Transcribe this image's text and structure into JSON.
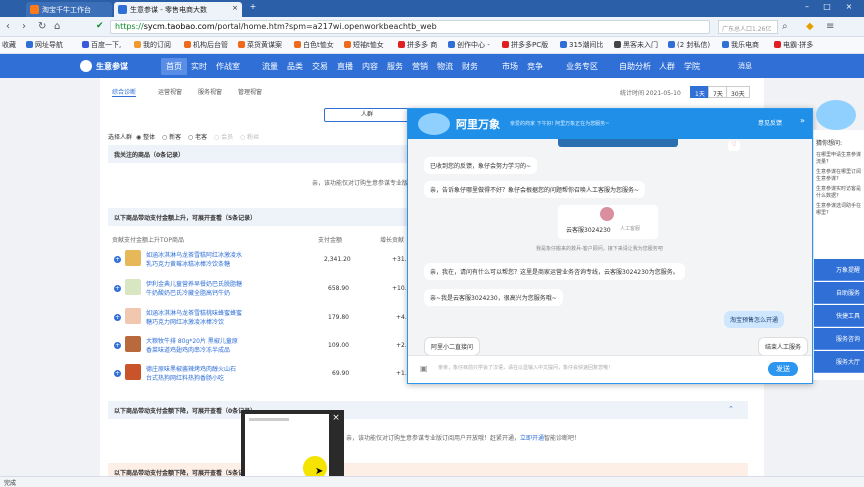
{
  "browser": {
    "tabs": [
      {
        "label": "淘宝千牛工作台",
        "active": false
      },
      {
        "label": "生意参谋 - 零售电商大数",
        "active": true
      }
    ],
    "url_scheme": "https://",
    "url_host": "sycm.taobao.com",
    "url_path": "/portal/home.htm?spm=a217wi.openworkbeachtb_web",
    "search_placeholder": "广东总人口1.26亿",
    "bookmarks": [
      "收藏",
      "网址导航",
      "百度一下,",
      "我的订阅",
      "机构后台管",
      "菜货黄谋案",
      "白色t恤女",
      "短袖t恤女",
      "拼多多 商",
      "创作中心 -",
      "拼多多PC版",
      "315潮间比",
      "黑客未入门",
      "(2 封私信)",
      "我乐电商",
      "电霸·拼多"
    ]
  },
  "sitenav": {
    "brand": "生意参谋",
    "items": [
      "首页",
      "实时",
      "作战室",
      "流量",
      "品类",
      "交易",
      "直播",
      "内容",
      "服务",
      "营销",
      "物流",
      "财务",
      "市场",
      "竞争",
      "业务专区",
      "自助分析",
      "人群",
      "学院"
    ],
    "active": "首页",
    "right": "消息"
  },
  "main": {
    "subtabs": [
      "综合诊断",
      "运营视窗",
      "服务视窗",
      "管理视窗"
    ],
    "stat_time": "统计时间 2021-05-10",
    "ranges": [
      "1天",
      "7天",
      "30天"
    ],
    "segment_left": "人群",
    "filter_label": "选择人群",
    "filters": [
      "整体",
      "新客",
      "老客",
      "会员",
      "粉丝"
    ],
    "section1_title": "我关注的商品（0条记录）",
    "section1_note": "亲，该功能仅对订购生意参谋专业版订阅用户开放",
    "section2_title": "以下商品带动支付金额上升，可展开查看（5条记录）",
    "col_name": "贡献支付金额上升TOP商品",
    "col_amount": "支付金额",
    "col_growth": "增长贡献",
    "rows": [
      {
        "name1": "如涵冰淇淋乌龙茶雪糕阿红冰激凌水",
        "name2": "乳巧克力黄莓冰糕冰棒冷饮条糖",
        "amount": "2,341.20",
        "growth": "+31."
      },
      {
        "name1": "伊利金典儿童营养早餐奶巴氏脱脂糖",
        "name2": "牛奶酸奶巴氏冷藏全脂高钙牛奶",
        "amount": "658.90",
        "growth": "+10."
      },
      {
        "name1": "如涵冰淇淋乌龙茶雪糕桃味蜂蜜蜂蜜",
        "name2": "糖巧克力网红冰激凌冰棒冷饮",
        "amount": "179.80",
        "growth": "+4."
      },
      {
        "name1": "大粮牧牛排 80g*20片 黑椒儿童原",
        "name2": "香菜味道鸡翅鸡肉串冷冻半成品",
        "amount": "109.00",
        "growth": "+2."
      },
      {
        "name1": "德庄原味黑椒酱辣烤鸡肉醇火山石",
        "name2": "台式热狗网红料热狗香肠小吃",
        "amount": "69.90",
        "growth": "+1."
      }
    ],
    "section3_title": "以下商品带动支付金额下降，可展开查看（0条记录）",
    "section3_note": "亲，该功能仅对订购生意参谋专业版订阅用户开放哦！赶紧开通，体验更多智能诊断吧！",
    "section3_link": "立即开通",
    "section4_title": "以下商品带动支付金额下降，可展开查看（5条记录）"
  },
  "chat": {
    "title": "阿里万象",
    "subtitle": "亲爱的商家 下午好! 阿里万象正在为您服务~",
    "feedback": "意见反馈",
    "messages": [
      {
        "text": "已收到您的反馈，象仔会努力学习的~",
        "side": "left"
      },
      {
        "text": "亲，告诉象仔哪里做得不好？象仔会根据您的问题帮你召唤人工客服为您服务~",
        "side": "left"
      },
      {
        "text": "我是象仔搬来的救兵-客户顾问，接下来请让我为您服务吧",
        "side": "system"
      },
      {
        "text": "亲，我在，请问有什么可以帮您？这里是商家运营业务咨询专线，云客服3024230为您服务。",
        "side": "left"
      },
      {
        "text": "亲~我是云客服3024230，很高兴为您服务哦~",
        "side": "left"
      },
      {
        "text": "淘宝预售怎么开通",
        "side": "right"
      }
    ],
    "agent_name": "云客服3024230",
    "agent_tag": "人工客服",
    "quick_reply": "阿里小二直接问",
    "end_button": "结束人工服务",
    "input_placeholder": "亲亲，象仔目前只学会了汉语，请在以显输入中文提问，象仔会快速回复您哦！",
    "send_label": "发送"
  },
  "right_panel": {
    "title": "猜你想问:",
    "questions": [
      "在哪里申请生意参谋流量?",
      "生意参谋在哪里订阅生意参谋?",
      "生意参谋实时访客是什么数据?",
      "生意参谋选词助手在哪里?"
    ],
    "buttons": [
      "万象提醒",
      "自助服务",
      "快捷工具",
      "服务咨询",
      "服务大厅"
    ]
  },
  "status": {
    "left": "完成"
  },
  "colors": {
    "brand_blue": "#2f6fd6",
    "chat_blue": "#1f8fe8",
    "tab_bar": "#2b5fa8"
  }
}
